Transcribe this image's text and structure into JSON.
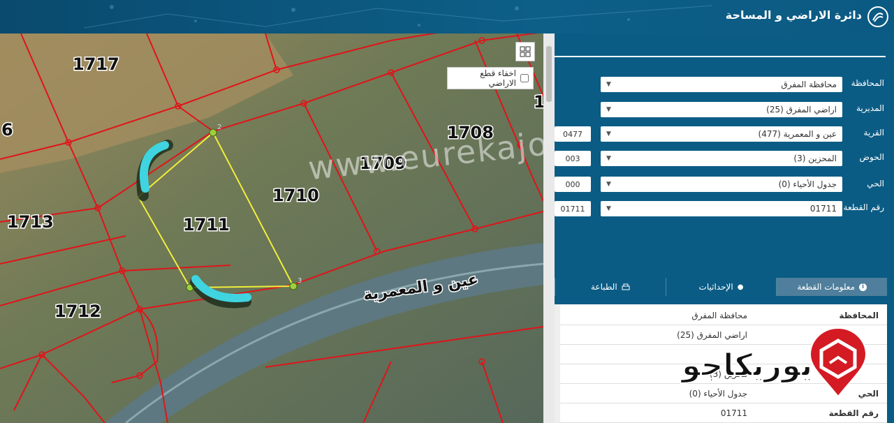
{
  "header": {
    "title": "دائرة الاراضي و المساحة"
  },
  "map": {
    "hide_parcels_label": "اخفاء قطع الاراضي",
    "hide_parcels_checked": false,
    "parcel_labels": [
      "1717",
      "1708",
      "1709",
      "1710",
      "1711",
      "1713",
      "1712",
      "6",
      "1"
    ],
    "place_name": "عين و المعمرية",
    "vertex_labels": [
      "2",
      "3"
    ],
    "watermark": "www.eurekajo.com"
  },
  "form": {
    "governorate": {
      "label": "المحافظة",
      "value": "محافظة المفرق"
    },
    "directorate": {
      "label": "المديرية",
      "value": "اراضي المفرق (25)"
    },
    "village": {
      "label": "القرية",
      "value": "عين و المعمرية (477)",
      "code": "0477"
    },
    "basin": {
      "label": "الحوض",
      "value": "المحزين (3)",
      "code": "003"
    },
    "neighborhood": {
      "label": "الحي",
      "value": "جدول الأحياء (0)",
      "code": "000"
    },
    "parcel": {
      "label": "رقم القطعة",
      "value": "01711",
      "code": "01711"
    }
  },
  "tabs": [
    {
      "label": "معلومات القطعة",
      "icon": "info-icon",
      "active": true
    },
    {
      "label": "الإحداثيات",
      "icon": "location-pin-icon",
      "active": false
    },
    {
      "label": "الطباعة",
      "icon": "printer-icon",
      "active": false
    }
  ],
  "info": {
    "rows": [
      {
        "key": "المحافظة",
        "value": "محافظة المفرق"
      },
      {
        "key": "",
        "value": "اراضي المفرق (25)"
      },
      {
        "key": "",
        "value": ""
      },
      {
        "key": "",
        "value": "محزين (3)"
      },
      {
        "key": "الحي",
        "value": "جدول الأحياء (0)"
      },
      {
        "key": "رقم القطعة",
        "value": "01711"
      }
    ]
  },
  "brand": {
    "text": "يوريكاجو"
  },
  "colors": {
    "header": "#0b5c85",
    "parcel_line": "#e0141a",
    "selected_parcel": "#f2ee3a",
    "highlight": "#3fd4e0"
  }
}
